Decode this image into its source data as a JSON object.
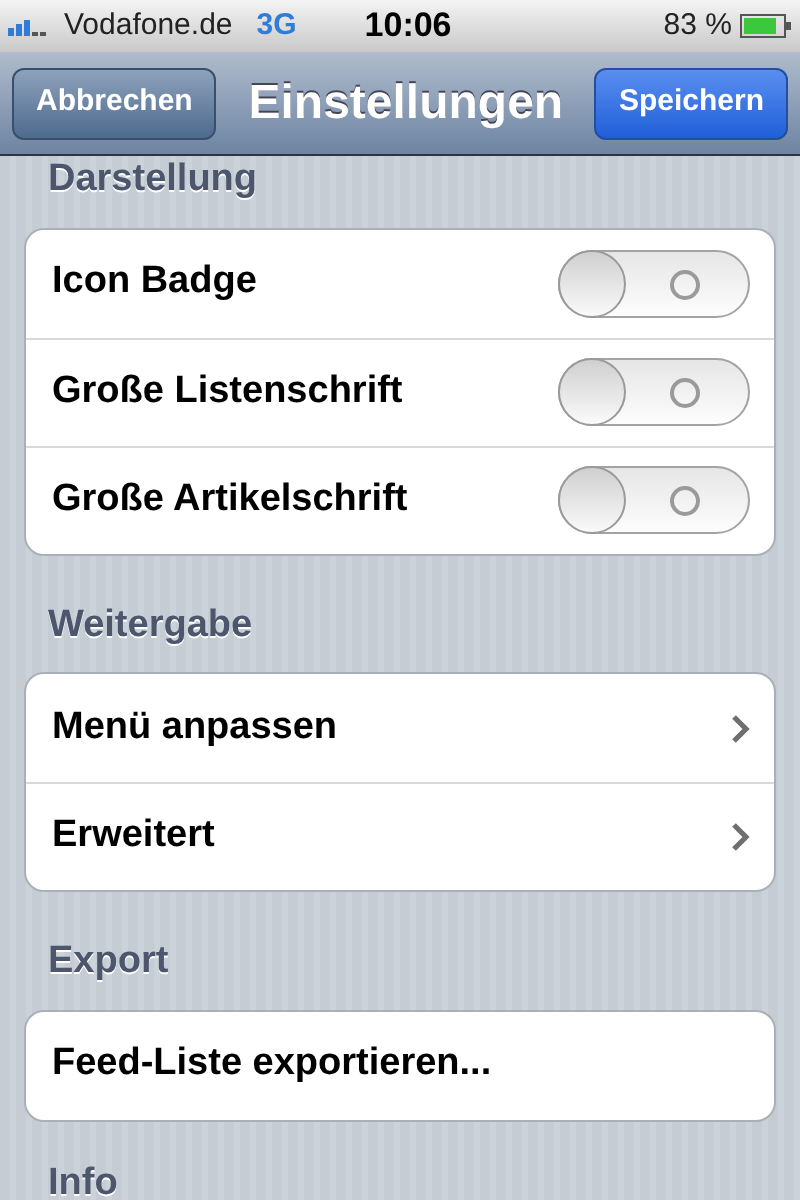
{
  "status_bar": {
    "carrier": "Vodafone.de",
    "network": "3G",
    "time": "10:06",
    "battery": "83 %"
  },
  "nav_bar": {
    "title": "Einstellungen",
    "left_button": "Abbrechen",
    "right_button": "Speichern"
  },
  "sections": [
    {
      "header": "Darstellung",
      "rows": [
        {
          "kind": "toggle",
          "label": "Icon Badge",
          "on": false
        },
        {
          "kind": "toggle",
          "label": "Große Listenschrift",
          "on": false
        },
        {
          "kind": "toggle",
          "label": "Große Artikelschrift",
          "on": false
        }
      ]
    },
    {
      "header": "Weitergabe",
      "rows": [
        {
          "kind": "link",
          "label": "Menü anpassen"
        },
        {
          "kind": "link",
          "label": "Erweitert"
        }
      ]
    },
    {
      "header": "Export",
      "rows": [
        {
          "kind": "action",
          "label": "Feed-Liste exportieren..."
        }
      ]
    },
    {
      "header": "Info"
    }
  ]
}
